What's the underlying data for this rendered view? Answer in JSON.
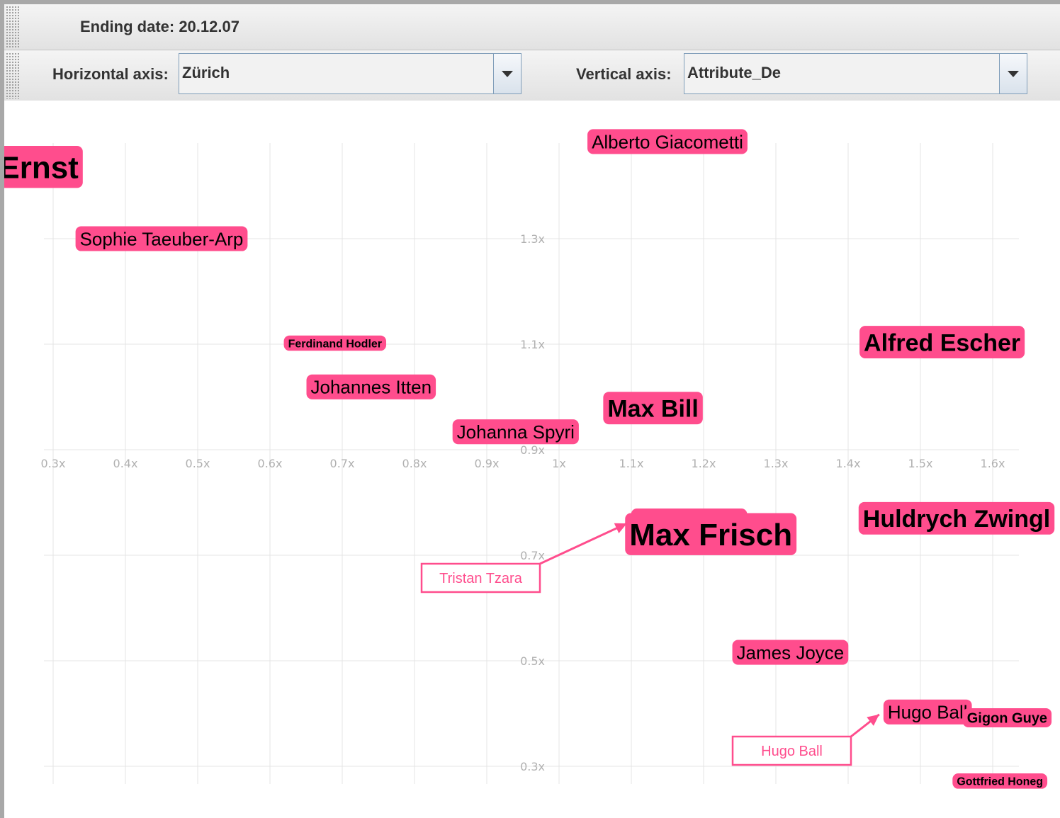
{
  "toolbar": {
    "ending_date": "Ending date: 20.12.07",
    "horizontal_label": "Horizontal axis:",
    "horizontal_value": "Zürich",
    "vertical_label": "Vertical axis:",
    "vertical_value": "Attribute_De"
  },
  "icons": {
    "dropdown": "chevron-down-icon",
    "grip": "drag-handle-icon"
  },
  "colors": {
    "tag": "#ff4d8d",
    "grid": "#e4e4e4",
    "tick": "#b0b0b0"
  },
  "chart_data": {
    "type": "scatter",
    "x_ticks": [
      "0.3x",
      "0.4x",
      "0.5x",
      "0.6x",
      "0.7x",
      "0.8x",
      "0.9x",
      "1x",
      "1.1x",
      "1.2x",
      "1.3x",
      "1.4x",
      "1.5x",
      "1.6x"
    ],
    "y_ticks": [
      "0.3x",
      "0.5x",
      "0.7x",
      "0.9x",
      "1.1x",
      "1.3x"
    ],
    "grid": true,
    "points": [
      {
        "label": "Max Ernst",
        "text": "ax Ernst",
        "x": 0.25,
        "y": 1.436,
        "weight": 5
      },
      {
        "label": "Alberto Giacometti",
        "x": 1.15,
        "y": 1.484,
        "weight": 3
      },
      {
        "label": "Sophie Taeuber-Arp",
        "x": 0.45,
        "y": 1.3,
        "weight": 3
      },
      {
        "label": "Ferdinand Hodler",
        "x": 0.69,
        "y": 1.102,
        "weight": 1
      },
      {
        "label": "Alfred Escher",
        "x": 1.53,
        "y": 1.104,
        "weight": 4
      },
      {
        "label": "Johannes Itten",
        "x": 0.74,
        "y": 1.019,
        "weight": 3
      },
      {
        "label": "Max Bill",
        "x": 1.13,
        "y": 0.979,
        "weight": 4
      },
      {
        "label": "Johanna Spyri",
        "x": 0.94,
        "y": 0.934,
        "weight": 3
      },
      {
        "label": "Tristan Tzara",
        "text": "Tristan Tzara",
        "x": 1.18,
        "y": 0.765,
        "weight": 3
      },
      {
        "label": "Max Frisch",
        "x": 1.21,
        "y": 0.74,
        "weight": 5
      },
      {
        "label": "Huldrych Zwingli",
        "text": "Huldrych Zwingl",
        "x": 1.55,
        "y": 0.77,
        "weight": 4
      },
      {
        "label": "James Joyce",
        "x": 1.32,
        "y": 0.516,
        "weight": 3
      },
      {
        "label": "Hugo Ball",
        "text": "Hugo Ball",
        "x": 1.51,
        "y": 0.403,
        "weight": 3
      },
      {
        "label": "Gigon Guyer",
        "text": "Gigon Guye",
        "x": 1.62,
        "y": 0.392,
        "weight": 2
      },
      {
        "label": "Gottfried Honegger",
        "text": "Gottfried Honeg",
        "x": 1.61,
        "y": 0.272,
        "weight": 1
      }
    ],
    "callouts": [
      {
        "label": "Tristan Tzara",
        "target": "Tristan Tzara"
      },
      {
        "label": "Hugo Ball",
        "target": "Hugo Ball"
      }
    ]
  }
}
